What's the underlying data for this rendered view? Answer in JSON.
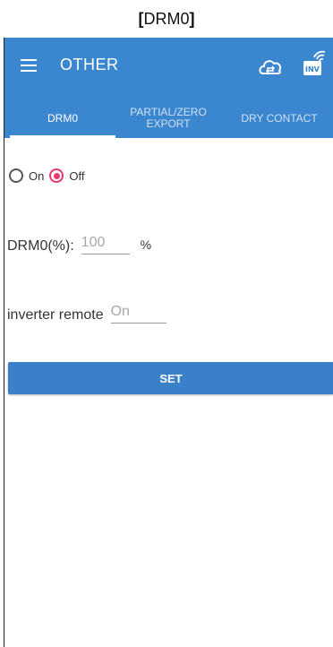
{
  "caption": {
    "bracket_open": "[",
    "title": "DRM0",
    "bracket_close": "]"
  },
  "appbar": {
    "title": "OTHER",
    "inv_badge": "INV"
  },
  "tabs": [
    {
      "label": "DRM0",
      "active": true
    },
    {
      "label": "PARTIAL/ZERO EXPORT",
      "active": false
    },
    {
      "label": "DRY CONTACT",
      "active": false
    }
  ],
  "drm_switch": {
    "on_label": "On",
    "off_label": "Off",
    "selected": "Off"
  },
  "drm_percent": {
    "label": "DRM0(%):",
    "value": "100",
    "unit": "%"
  },
  "inverter_remote": {
    "label": "inverter remote",
    "value": "On"
  },
  "set_button": {
    "label": "SET"
  },
  "colors": {
    "primary": "#3a86cf",
    "accent": "#e8396b",
    "button": "#3a80c9"
  }
}
